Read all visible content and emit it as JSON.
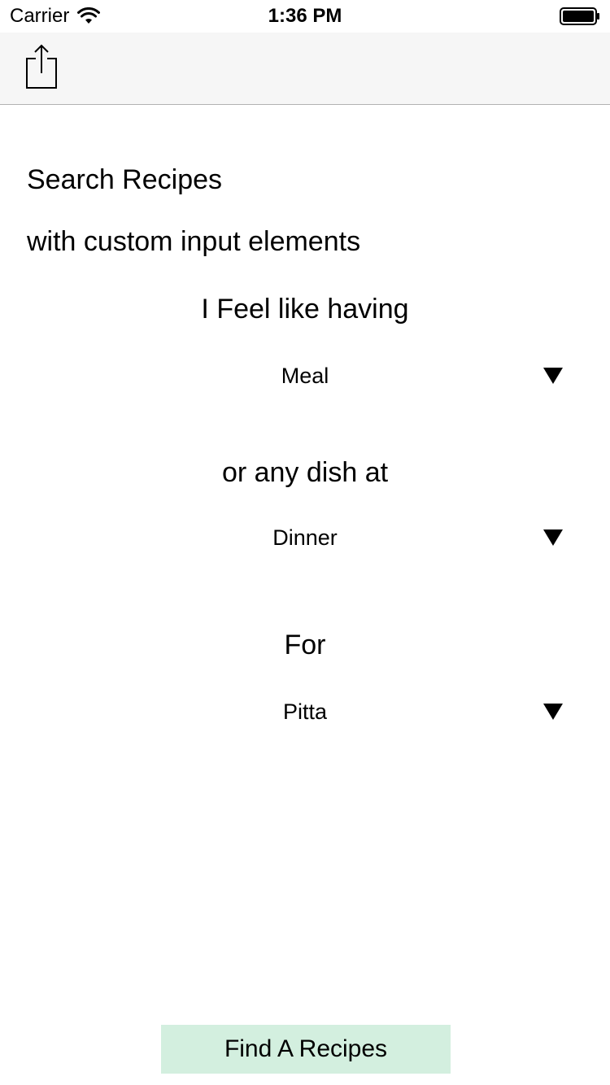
{
  "status_bar": {
    "carrier": "Carrier",
    "time": "1:36 PM",
    "wifi_icon": "wifi-icon",
    "battery_icon": "battery-full-icon"
  },
  "toolbar": {
    "share_icon": "share-icon"
  },
  "content": {
    "title": "Search Recipes",
    "subtitle": "with custom input elements",
    "sections": [
      {
        "label": "I Feel like having",
        "selected": "Meal"
      },
      {
        "label": "or any dish at",
        "selected": "Dinner"
      },
      {
        "label": "For",
        "selected": "Pitta"
      }
    ],
    "dropdown_icon": "dropdown-arrow-icon"
  },
  "actions": {
    "find_button": "Find A Recipes"
  },
  "colors": {
    "nav_bg": "#f6f6f6",
    "button_bg": "#d3efdf",
    "text": "#000000"
  }
}
